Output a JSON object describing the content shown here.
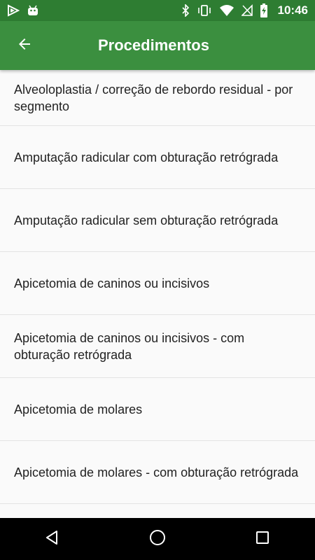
{
  "status_bar": {
    "time": "10:46",
    "left_icons": [
      "play-store-icon",
      "android-icon"
    ],
    "right_icons": [
      "bluetooth-icon",
      "vibrate-icon",
      "wifi-icon",
      "no-sim-icon",
      "battery-charging-icon"
    ]
  },
  "app_bar": {
    "title": "Procedimentos",
    "back_icon": "arrow-back-icon"
  },
  "procedures": [
    "Alveoloplastia / correção de rebordo residual - por segmento",
    "Amputação radicular com obturação retrógrada",
    "Amputação radicular sem obturação retrógrada",
    "Apicetomia de caninos ou incisivos",
    "Apicetomia de caninos ou incisivos - com obturação retrógrada",
    "Apicetomia de molares",
    "Apicetomia de molares - com obturação retrógrada"
  ],
  "nav_bar": {
    "icons": [
      "back-triangle-icon",
      "home-circle-icon",
      "recents-square-icon"
    ]
  },
  "colors": {
    "status_bar": "#2e7d32",
    "app_bar": "#3b8f3f",
    "background": "#fafafa",
    "nav_bar": "#000000"
  }
}
